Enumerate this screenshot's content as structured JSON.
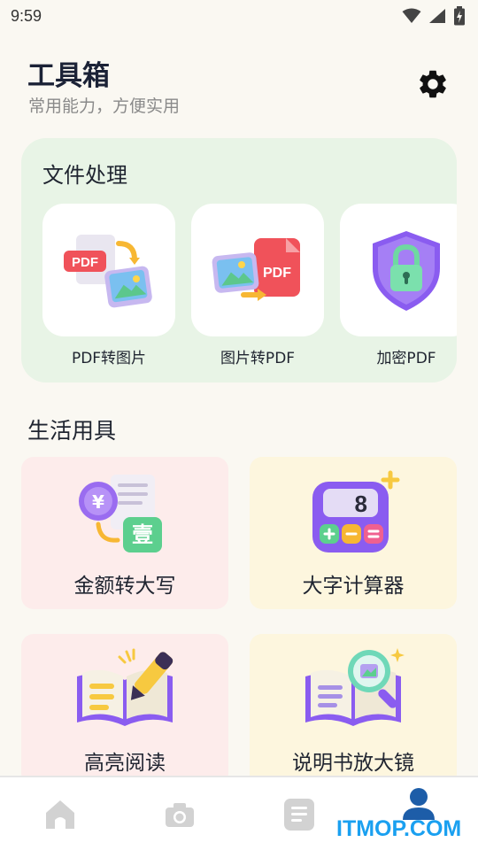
{
  "status_bar": {
    "time": "9:59",
    "icons": [
      "wifi-icon",
      "signal-icon",
      "battery-charging-icon"
    ]
  },
  "header": {
    "title": "工具箱",
    "subtitle": "常用能力，方便实用",
    "settings_icon": "gear-icon"
  },
  "file_section": {
    "title": "文件处理",
    "items": [
      {
        "label": "PDF转图片",
        "icon": "pdf-to-image-icon"
      },
      {
        "label": "图片转PDF",
        "icon": "image-to-pdf-icon"
      },
      {
        "label": "加密PDF",
        "icon": "lock-shield-icon"
      }
    ]
  },
  "life_section": {
    "title": "生活用具",
    "items": [
      {
        "label": "金额转大写",
        "icon": "yuan-convert-icon"
      },
      {
        "label": "大字计算器",
        "icon": "calculator-icon"
      },
      {
        "label": "高亮阅读",
        "icon": "highlight-book-icon"
      },
      {
        "label": "说明书放大镜",
        "icon": "magnifier-book-icon"
      }
    ]
  },
  "calculator_display": "8",
  "pdf_badge": "PDF",
  "amount_glyphs": {
    "currency": "¥",
    "capital": "壹"
  },
  "bottom_nav": [
    {
      "icon": "home-icon"
    },
    {
      "icon": "camera-icon"
    },
    {
      "icon": "document-icon"
    },
    {
      "icon": "profile-icon"
    }
  ],
  "colors": {
    "accent": "#1d5da8",
    "file_bg": "#e8f4e6",
    "pink_card": "#fdeceb",
    "yellow_card": "#fdf6de"
  },
  "watermark": "ITMOP.COM"
}
